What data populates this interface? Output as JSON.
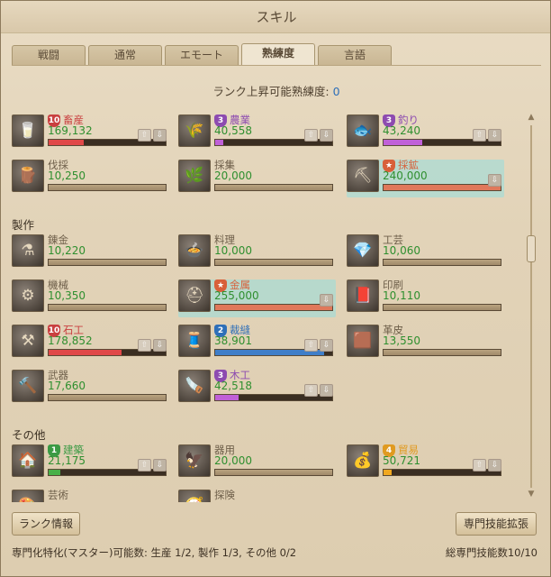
{
  "window": {
    "title": "スキル"
  },
  "tabs": [
    "戦闘",
    "通常",
    "エモート",
    "熟練度",
    "言語"
  ],
  "active_tab": 3,
  "rank_up": {
    "label": "ランク上昇可能熟練度: ",
    "value": "0"
  },
  "sections": {
    "craft": "製作",
    "other": "その他"
  },
  "skills": [
    {
      "name": "畜産",
      "value": "169,132",
      "rank": "10",
      "badge_color": "#c94040",
      "fill": 0.3,
      "bar_color": "#e04848",
      "icon": "livestock-icon",
      "glyph": "🥛",
      "buttons": true,
      "highlight": false
    },
    {
      "name": "農業",
      "value": "40,558",
      "rank": "3",
      "badge_color": "#8d4bb0",
      "fill": 0.07,
      "bar_color": "#c060d8",
      "icon": "farming-icon",
      "glyph": "🌾",
      "buttons": true,
      "highlight": false
    },
    {
      "name": "釣り",
      "value": "43,240",
      "rank": "3",
      "badge_color": "#8d4bb0",
      "fill": 0.33,
      "bar_color": "#c060d8",
      "icon": "fishing-icon",
      "glyph": "🐟",
      "buttons": true,
      "highlight": false
    },
    {
      "name": "伐採",
      "value": "10,250",
      "rank": "",
      "badge_color": "",
      "fill": 0.0,
      "bar_color": "#a08a6a",
      "icon": "logging-icon",
      "glyph": "🪵",
      "buttons": false,
      "highlight": false
    },
    {
      "name": "採集",
      "value": "20,000",
      "rank": "",
      "badge_color": "",
      "fill": 0.0,
      "bar_color": "#a08a6a",
      "icon": "gathering-icon",
      "glyph": "🌿",
      "buttons": false,
      "highlight": false
    },
    {
      "name": "採鉱",
      "value": "240,000",
      "rank": "★",
      "badge_color": "#d8603a",
      "fill": 1.0,
      "bar_color": "#e0785a",
      "icon": "mining-icon",
      "glyph": "⛏",
      "buttons": "down",
      "highlight": true
    },
    {
      "name": "錬金",
      "value": "10,220",
      "rank": "",
      "badge_color": "",
      "fill": 0.0,
      "bar_color": "#a08a6a",
      "icon": "alchemy-icon",
      "glyph": "⚗",
      "buttons": false,
      "highlight": false
    },
    {
      "name": "料理",
      "value": "10,000",
      "rank": "",
      "badge_color": "",
      "fill": 0.0,
      "bar_color": "#a08a6a",
      "icon": "cooking-icon",
      "glyph": "🍲",
      "buttons": false,
      "highlight": false
    },
    {
      "name": "工芸",
      "value": "10,060",
      "rank": "",
      "badge_color": "",
      "fill": 0.0,
      "bar_color": "#a08a6a",
      "icon": "handicraft-icon",
      "glyph": "💎",
      "buttons": false,
      "highlight": false
    },
    {
      "name": "機械",
      "value": "10,350",
      "rank": "",
      "badge_color": "",
      "fill": 0.0,
      "bar_color": "#a08a6a",
      "icon": "machinery-icon",
      "glyph": "⚙",
      "buttons": false,
      "highlight": false
    },
    {
      "name": "金属",
      "value": "255,000",
      "rank": "★",
      "badge_color": "#d8603a",
      "fill": 1.0,
      "bar_color": "#e0785a",
      "icon": "metalwork-icon",
      "glyph": "⛑",
      "buttons": "down",
      "highlight": true
    },
    {
      "name": "印刷",
      "value": "10,110",
      "rank": "",
      "badge_color": "",
      "fill": 0.0,
      "bar_color": "#a08a6a",
      "icon": "printing-icon",
      "glyph": "📕",
      "buttons": false,
      "highlight": false
    },
    {
      "name": "石工",
      "value": "178,852",
      "rank": "10",
      "badge_color": "#c94040",
      "fill": 0.62,
      "bar_color": "#e04848",
      "icon": "masonry-icon",
      "glyph": "⚒",
      "buttons": true,
      "highlight": false
    },
    {
      "name": "裁縫",
      "value": "38,901",
      "rank": "2",
      "badge_color": "#2e6fb8",
      "fill": 0.93,
      "bar_color": "#3f7ec8",
      "icon": "tailoring-icon",
      "glyph": "🧵",
      "buttons": true,
      "highlight": false
    },
    {
      "name": "革皮",
      "value": "13,550",
      "rank": "",
      "badge_color": "",
      "fill": 0.0,
      "bar_color": "#a08a6a",
      "icon": "leatherwork-icon",
      "glyph": "🟫",
      "buttons": false,
      "highlight": false
    },
    {
      "name": "武器",
      "value": "17,660",
      "rank": "",
      "badge_color": "",
      "fill": 0.0,
      "bar_color": "#a08a6a",
      "icon": "weaponry-icon",
      "glyph": "🔨",
      "buttons": false,
      "highlight": false
    },
    {
      "name": "木工",
      "value": "42,518",
      "rank": "3",
      "badge_color": "#8d4bb0",
      "fill": 0.2,
      "bar_color": "#c060d8",
      "icon": "carpentry-icon",
      "glyph": "🪚",
      "buttons": true,
      "highlight": false
    },
    {
      "name": "建築",
      "value": "21,175",
      "rank": "1",
      "badge_color": "#3b9a44",
      "fill": 0.1,
      "bar_color": "#48b048",
      "icon": "construction-icon",
      "glyph": "🏠",
      "buttons": true,
      "highlight": false
    },
    {
      "name": "器用",
      "value": "20,000",
      "rank": "",
      "badge_color": "",
      "fill": 0.0,
      "bar_color": "#a08a6a",
      "icon": "dexterity-icon",
      "glyph": "🦅",
      "buttons": false,
      "highlight": false
    },
    {
      "name": "貿易",
      "value": "50,721",
      "rank": "4",
      "badge_color": "#e09a20",
      "fill": 0.07,
      "bar_color": "#f0a820",
      "icon": "commerce-icon",
      "glyph": "💰",
      "buttons": true,
      "highlight": false
    },
    {
      "name": "芸術",
      "value": "",
      "rank": "",
      "badge_color": "",
      "fill": 0.0,
      "bar_color": "#a08a6a",
      "icon": "artistry-icon",
      "glyph": "🎨",
      "buttons": false,
      "highlight": false
    },
    {
      "name": "探険",
      "value": "",
      "rank": "",
      "badge_color": "",
      "fill": 0.0,
      "bar_color": "#a08a6a",
      "icon": "exploration-icon",
      "glyph": "🧭",
      "buttons": false,
      "highlight": false
    }
  ],
  "footer": {
    "rank_info_button": "ランク情報",
    "expand_button": "専門技能拡張",
    "mastery": "専門化特化(マスター)可能数: 生産 1/2, 製作 1/3, その他 0/2",
    "total": "総専門技能数10/10"
  }
}
